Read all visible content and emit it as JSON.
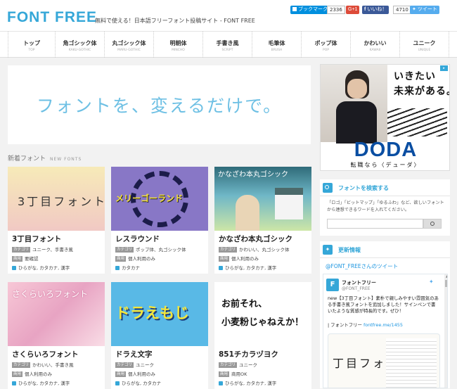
{
  "header": {
    "logo": "FONT FREE",
    "tagline": "無料で使える！日本語フリーフォント投稿サイト - FONT FREE",
    "share": {
      "hatena_label": "ブックマーク",
      "hatena_count": "2336",
      "gplus_label": "G+1",
      "facebook_label": "いいね！",
      "facebook_count": "4710",
      "twitter_label": "ツイート"
    }
  },
  "nav": [
    {
      "jp": "トップ",
      "en": "TOP"
    },
    {
      "jp": "角ゴシック体",
      "en": "KAKU-GOTHIC"
    },
    {
      "jp": "丸ゴシック体",
      "en": "MARU-GOTHIC"
    },
    {
      "jp": "明朝体",
      "en": "MINCHO"
    },
    {
      "jp": "手書き風",
      "en": "SCRIPT"
    },
    {
      "jp": "毛筆体",
      "en": "BRUSH"
    },
    {
      "jp": "ポップ体",
      "en": "POP"
    },
    {
      "jp": "かわいい",
      "en": "KAWAII"
    },
    {
      "jp": "ユニーク",
      "en": "UNIQUE"
    }
  ],
  "hero": {
    "text": "フォントを、変えるだけで。"
  },
  "section": {
    "title": "新着フォント",
    "title_en": "NEW FONTS"
  },
  "cards": [
    {
      "title": "3丁目フォント",
      "thumb_text": "3丁目フォント",
      "category_tag": "カテゴリ",
      "categories": "ユニーク、手書き風",
      "usage_tag": "商用",
      "usage": "要確認",
      "glyphs": "ひらがな, カタカナ, 漢字"
    },
    {
      "title": "レスラウンド",
      "thumb_text": "メリーゴーランド",
      "category_tag": "カテゴリ",
      "categories": "ポップ体、丸ゴシック体",
      "usage_tag": "商用",
      "usage": "個人利用のみ",
      "glyphs": "カタカナ"
    },
    {
      "title": "かなざわ本丸ゴシック",
      "thumb_text": "かなざわ本丸ゴシック",
      "category_tag": "カテゴリ",
      "categories": "かわいい、丸ゴシック体",
      "usage_tag": "商用",
      "usage": "個人利用のみ",
      "glyphs": "ひらがな, カタカナ, 漢字"
    },
    {
      "title": "さくらいろフォント",
      "thumb_text": "さくらいろフォント",
      "category_tag": "カテゴリ",
      "categories": "かわいい、手書き風",
      "usage_tag": "商用",
      "usage": "個人利用のみ",
      "glyphs": "ひらがな, カタカナ, 漢字"
    },
    {
      "title": "ドラえ文字",
      "thumb_text": "ドラえもじ",
      "category_tag": "カテゴリ",
      "categories": "ユニーク",
      "usage_tag": "商用",
      "usage": "個人利用のみ",
      "glyphs": "ひらがな, カタカナ"
    },
    {
      "title": "851チカラヅヨク",
      "thumb_text_1": "お前それ、",
      "thumb_text_2": "小麦粉じゃねえか！",
      "category_tag": "カテゴリ",
      "categories": "ユニーク",
      "usage_tag": "商用",
      "usage": "商用OK",
      "glyphs": "ひらがな, カタカナ, 漢字"
    }
  ],
  "ad": {
    "line1": "いきたい",
    "line2": "未来がある。",
    "brand": "DODA",
    "tagline": "転職なら〈デューダ〉"
  },
  "search_widget": {
    "title": "フォントを検索する",
    "hint": "「ロゴ」「ビットマップ」「ゆるふわ」など、欲しいフォントから連想できるワードを入れてください。",
    "placeholder": ""
  },
  "news_widget": {
    "title": "更新情報",
    "tweets_label": "@FONT_FREEさんのツイート",
    "account_name": "フォントフリー",
    "account_handle": "@FONT_FREE",
    "tweet_text": "new【3丁目フォント】素朴で親しみやすい雰囲気のある手書き風フォントを追加しました！サインペンで書いたような質感が特長的です。ぜひ！",
    "tweet_link_prefix": "| フォントフリー",
    "tweet_link": "fontfree.me/1455",
    "preview_text": "丁目フォン"
  },
  "colors": {
    "brand": "#35a7d8",
    "facebook": "#3b5998",
    "twitter": "#55acee",
    "hatena": "#008fde",
    "gplus": "#dd4b39",
    "doda": "#0a4ea2"
  }
}
